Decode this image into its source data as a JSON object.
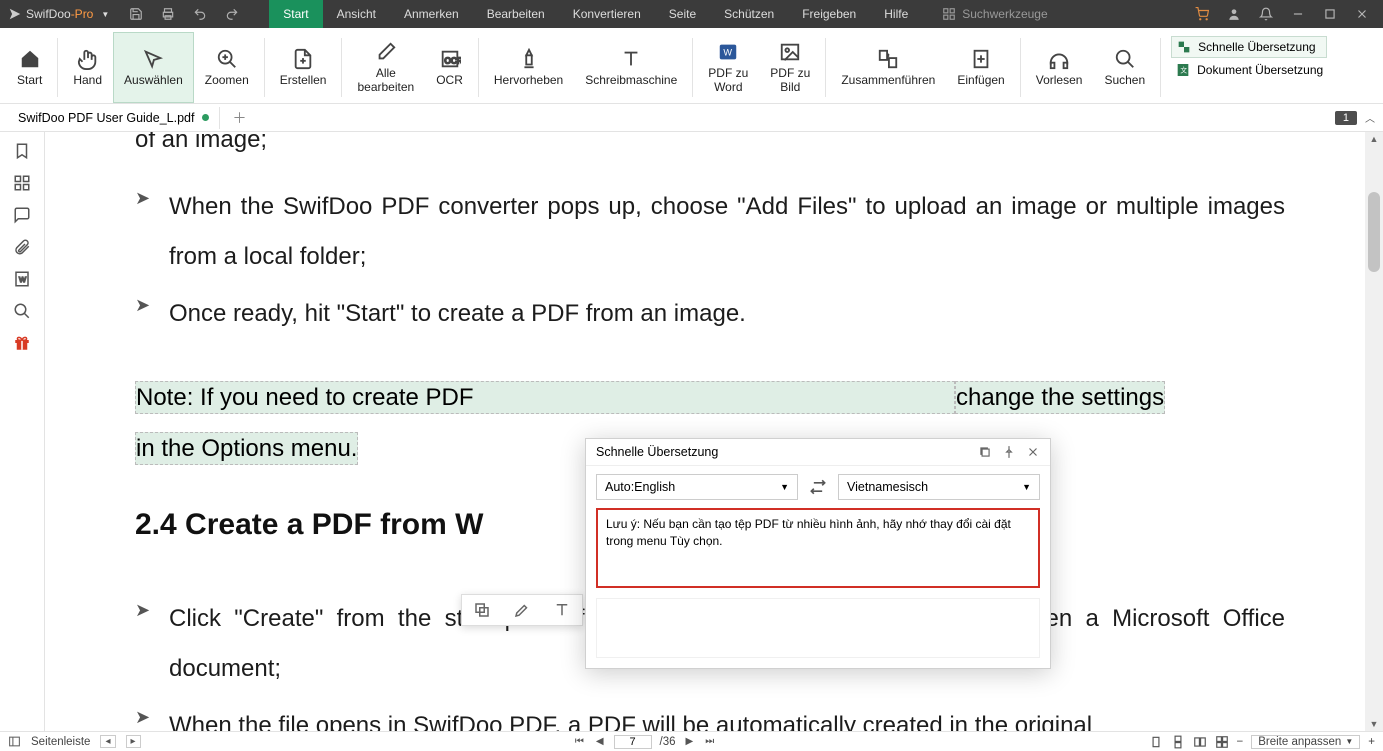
{
  "app": {
    "brand1": "SwifDoo",
    "brand2": "-Pro"
  },
  "menu": [
    "Start",
    "Ansicht",
    "Anmerken",
    "Bearbeiten",
    "Konvertieren",
    "Seite",
    "Schützen",
    "Freigeben",
    "Hilfe"
  ],
  "search": {
    "placeholder": "Suchwerkzeuge"
  },
  "ribbon": {
    "start": "Start",
    "hand": "Hand",
    "select": "Auswählen",
    "zoom": "Zoomen",
    "create": "Erstellen",
    "editall": "Alle\nbearbeiten",
    "ocr": "OCR",
    "highlight": "Hervorheben",
    "type": "Schreibmaschine",
    "toword": "PDF zu\nWord",
    "toimg": "PDF zu\nBild",
    "merge": "Zusammenführen",
    "insert": "Einfügen",
    "read": "Vorlesen",
    "browse": "Suchen",
    "quicktrans": "Schnelle Übersetzung",
    "doctrans": "Dokument Übersetzung"
  },
  "tab": {
    "name": "SwifDoo PDF User Guide_L.pdf"
  },
  "pageBadge": "1",
  "doc": {
    "cut": "of an image;",
    "b1": "When the SwifDoo PDF converter pops up, choose \"Add Files\" to upload an image or multiple images from a local folder;",
    "b2": "Once ready, hit \"Start\" to create a PDF from an image.",
    "noteP1": "Note: If you need to create PDF",
    "noteP2": "change the settings",
    "noteP3": "in the Options menu.",
    "heading": "2.4 Create a PDF from W",
    "b3": "Click \"Create\" from the startup interface, and then choose \"From File\" to open a Microsoft Office document;",
    "b4": "When the file opens in SwifDoo PDF, a PDF will be automatically created in the original"
  },
  "translate": {
    "title": "Schnelle Übersetzung",
    "from": "Auto:English",
    "to": "Vietnamesisch",
    "result": "Lưu ý: Nếu bạn cần tạo tệp PDF từ nhiều hình ảnh, hãy nhớ thay đổi cài đặt trong menu Tùy chọn."
  },
  "status": {
    "side": "Seitenleiste",
    "page": "7",
    "total": "/36",
    "zoom": "Breite anpassen"
  }
}
